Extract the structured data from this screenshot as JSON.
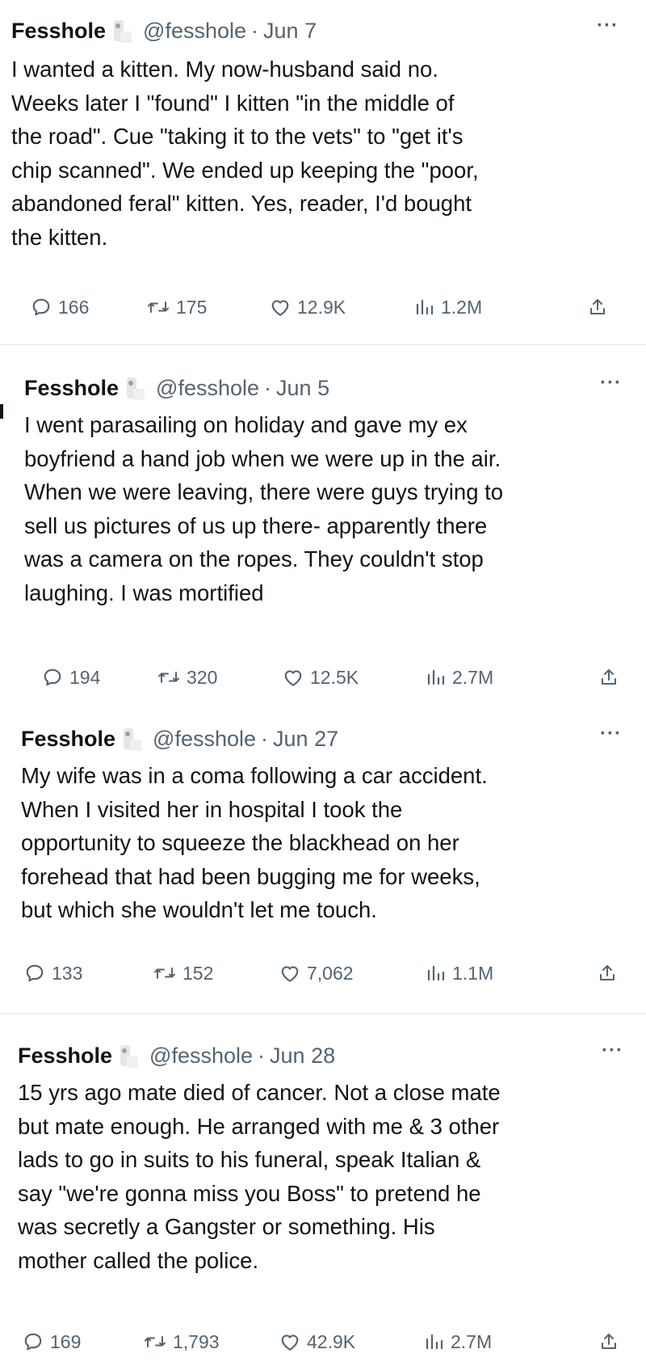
{
  "tweets": [
    {
      "name": "Fesshole",
      "handle": "@fesshole",
      "separator": "·",
      "date": "Jun 7",
      "more": "···",
      "text": "I wanted a kitten. My now-husband said no.\nWeeks later I \"found\" I kitten \"in the middle of\nthe road\". Cue \"taking it to the vets\" to \"get it's\nchip scanned\". We ended up keeping the \"poor,\nabandoned feral\" kitten. Yes, reader, I'd bought\nthe kitten.",
      "replies": "166",
      "reposts": "175",
      "likes": "12.9K",
      "views": "1.2M"
    },
    {
      "name": "Fesshole",
      "handle": "@fesshole",
      "separator": "·",
      "date": "Jun 5",
      "more": "···",
      "text": "I went parasailing on holiday and gave my ex\nboyfriend a hand job when we were up in the air.\nWhen we were leaving, there were guys trying to\nsell us pictures of us up there- apparently there\nwas a camera on the ropes. They couldn't stop\nlaughing. I was mortified",
      "replies": "194",
      "reposts": "320",
      "likes": "12.5K",
      "views": "2.7M"
    },
    {
      "name": "Fesshole",
      "handle": "@fesshole",
      "separator": "·",
      "date": "Jun 27",
      "more": "···",
      "text": "My wife was in a coma following a car accident.\nWhen I visited her in hospital I took the\nopportunity to squeeze the blackhead on her\nforehead that had been bugging me for weeks,\nbut which she wouldn't let me touch.",
      "replies": "133",
      "reposts": "152",
      "likes": "7,062",
      "views": "1.1M"
    },
    {
      "name": "Fesshole",
      "handle": "@fesshole",
      "separator": "·",
      "date": "Jun 28",
      "more": "···",
      "text": "15 yrs ago mate died of cancer. Not a close mate\nbut mate enough. He arranged with me & 3 other\nlads to go in suits to his funeral, speak Italian &\nsay \"we're gonna miss you Boss\" to pretend he\nwas secretly a Gangster or something. His\nmother called the police.",
      "replies": "169",
      "reposts": "1,793",
      "likes": "42.9K",
      "views": "2.7M"
    }
  ],
  "icons": {
    "reply": "speech-bubble-icon",
    "repost": "repost-arrows-icon",
    "like": "heart-icon",
    "views": "bar-chart-icon",
    "share": "share-upload-icon"
  },
  "colors": {
    "text": "#0f1419",
    "muted": "#536471"
  }
}
